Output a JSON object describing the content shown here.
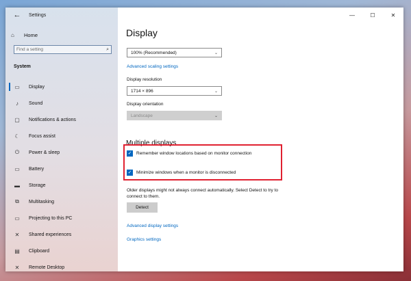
{
  "window": {
    "title": "Settings"
  },
  "titlebar": {
    "back_icon": "back-arrow-icon"
  },
  "sidebar": {
    "home_label": "Home",
    "search_placeholder": "Find a setting",
    "section_label": "System",
    "items": [
      {
        "label": "Display",
        "icon": "display-icon",
        "glyph": "▭",
        "active": true
      },
      {
        "label": "Sound",
        "icon": "speaker-icon",
        "glyph": "♪",
        "active": false
      },
      {
        "label": "Notifications & actions",
        "icon": "notification-icon",
        "glyph": "▢",
        "active": false
      },
      {
        "label": "Focus assist",
        "icon": "moon-icon",
        "glyph": "☾",
        "active": false
      },
      {
        "label": "Power & sleep",
        "icon": "power-icon",
        "glyph": "⏻",
        "active": false
      },
      {
        "label": "Battery",
        "icon": "battery-icon",
        "glyph": "▭",
        "active": false
      },
      {
        "label": "Storage",
        "icon": "storage-icon",
        "glyph": "▬",
        "active": false
      },
      {
        "label": "Multitasking",
        "icon": "multitasking-icon",
        "glyph": "⧉",
        "active": false
      },
      {
        "label": "Projecting to this PC",
        "icon": "projecting-icon",
        "glyph": "▭",
        "active": false
      },
      {
        "label": "Shared experiences",
        "icon": "shared-icon",
        "glyph": "✕",
        "active": false
      },
      {
        "label": "Clipboard",
        "icon": "clipboard-icon",
        "glyph": "▤",
        "active": false
      },
      {
        "label": "Remote Desktop",
        "icon": "remote-desktop-icon",
        "glyph": "✕",
        "active": false
      }
    ]
  },
  "main": {
    "title": "Display",
    "scale_value": "100% (Recommended)",
    "advanced_scaling_link": "Advanced scaling settings",
    "resolution_label": "Display resolution",
    "resolution_value": "1714 × 896",
    "orientation_label": "Display orientation",
    "orientation_value": "Landscape",
    "multiple_displays_heading": "Multiple displays",
    "checkbox_remember": "Remember window locations based on monitor connection",
    "checkbox_minimize": "Minimize windows when a monitor is disconnected",
    "detect_note": "Older displays might not always connect automatically. Select Detect to try to connect to them.",
    "detect_button": "Detect",
    "advanced_display_link": "Advanced display settings",
    "graphics_link": "Graphics settings"
  },
  "colors": {
    "accent": "#0067c0",
    "highlight_border": "#e02030",
    "disabled_dropdown": "#cfcfcf"
  }
}
